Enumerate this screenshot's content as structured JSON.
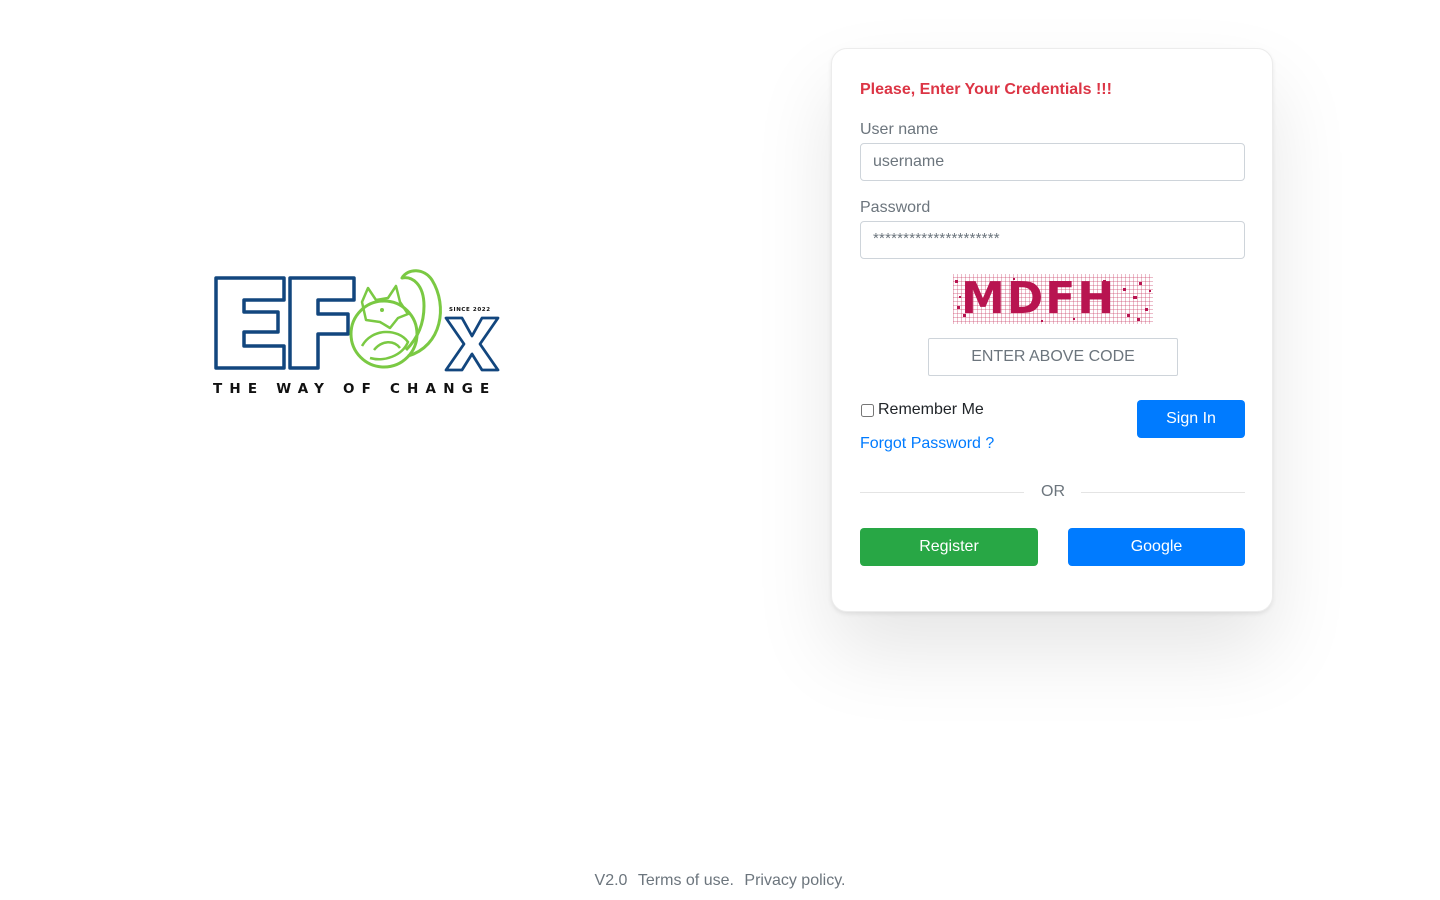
{
  "brand": {
    "logo_text": "EFOX",
    "tagline": "THE WAY OF CHANGE",
    "since": "SINCE 2022",
    "colors": {
      "letters": "#12467e",
      "fox": "#7ac943",
      "tagline": "#111111"
    }
  },
  "login": {
    "heading": "Please, Enter Your Credentials !!!",
    "username_label": "User name",
    "username_placeholder": "username",
    "password_label": "Password",
    "password_value": "*********************",
    "captcha_text": "MDFH",
    "captcha_placeholder": "ENTER ABOVE CODE",
    "remember_label": "Remember Me",
    "remember_checked": false,
    "forgot_label": "Forgot Password ?",
    "signin_label": "Sign In",
    "divider_label": "OR",
    "register_label": "Register",
    "google_label": "Google"
  },
  "colors": {
    "heading": "#dc3545",
    "primary": "#007bff",
    "success": "#28a745",
    "muted": "#6c757d"
  },
  "footer": {
    "version": "V2.0",
    "terms_label": "Terms of use.",
    "privacy_label": "Privacy policy."
  }
}
